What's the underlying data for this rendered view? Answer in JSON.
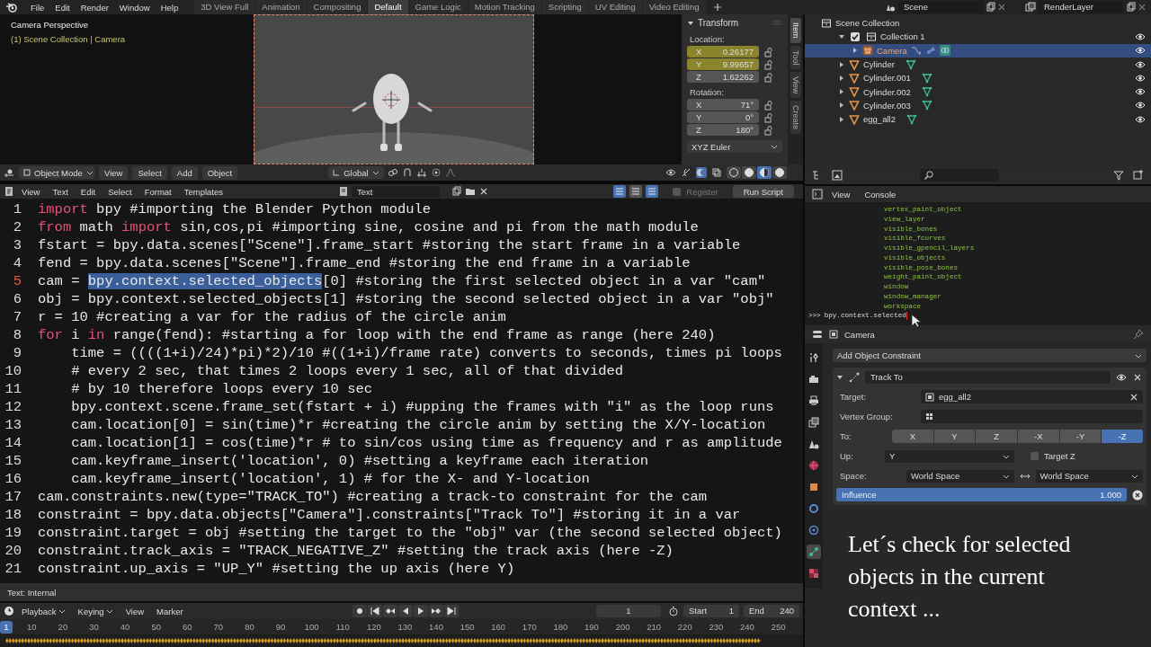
{
  "menu": [
    "File",
    "Edit",
    "Render",
    "Window",
    "Help"
  ],
  "workspaces": [
    {
      "label": "3D View Full",
      "selected": false
    },
    {
      "label": "Animation",
      "selected": false
    },
    {
      "label": "Compositing",
      "selected": false
    },
    {
      "label": "Default",
      "selected": true
    },
    {
      "label": "Game Logic",
      "selected": false
    },
    {
      "label": "Motion Tracking",
      "selected": false
    },
    {
      "label": "Scripting",
      "selected": false
    },
    {
      "label": "UV Editing",
      "selected": false
    },
    {
      "label": "Video Editing",
      "selected": false
    }
  ],
  "scene": "Scene",
  "view_layer": "RenderLayer",
  "viewport": {
    "title": "Camera Perspective",
    "subtitle": "(1) Scene Collection | Camera",
    "mode": "Object Mode",
    "menus": [
      "View",
      "Select",
      "Add",
      "Object"
    ],
    "orientation": "Global",
    "shading_modes": [
      {
        "selected": false
      },
      {
        "selected": false
      },
      {
        "selected": true
      },
      {
        "selected": false
      }
    ]
  },
  "sidebar": {
    "tabs": [
      {
        "label": "Item",
        "selected": true
      },
      {
        "label": "Tool",
        "selected": false
      },
      {
        "label": "View",
        "selected": false
      },
      {
        "label": "Create",
        "selected": false
      }
    ],
    "panel_title": "Transform",
    "location_label": "Location:",
    "location": [
      {
        "axis": "X",
        "value": "0.26177",
        "keyed": true
      },
      {
        "axis": "Y",
        "value": "9.99657",
        "keyed": true
      },
      {
        "axis": "Z",
        "value": "1.62262",
        "keyed": false
      }
    ],
    "rotation_label": "Rotation:",
    "rotation": [
      {
        "axis": "X",
        "value": "71°",
        "keyed": false
      },
      {
        "axis": "Y",
        "value": "0°",
        "keyed": false
      },
      {
        "axis": "Z",
        "value": "180°",
        "keyed": false
      }
    ],
    "rotation_mode": "XYZ Euler"
  },
  "outliner": {
    "root": "Scene Collection",
    "items": [
      {
        "name": "Collection 1",
        "kind": "collection",
        "checked": true,
        "expanded": true,
        "selected": false,
        "children": [
          {
            "name": "Camera",
            "kind": "camera",
            "expanded": false,
            "selected": true
          }
        ]
      },
      {
        "name": "Cylinder",
        "kind": "mesh",
        "expanded": false,
        "selected": false
      },
      {
        "name": "Cylinder.001",
        "kind": "mesh",
        "expanded": false,
        "selected": false
      },
      {
        "name": "Cylinder.002",
        "kind": "mesh",
        "expanded": false,
        "selected": false
      },
      {
        "name": "Cylinder.003",
        "kind": "mesh",
        "expanded": false,
        "selected": false
      },
      {
        "name": "egg_all2",
        "kind": "mesh",
        "expanded": false,
        "selected": false
      }
    ]
  },
  "text_editor": {
    "menus": [
      "View",
      "Text",
      "Edit",
      "Select",
      "Format",
      "Templates"
    ],
    "text_name": "Text",
    "toggles": [
      {
        "on": true
      },
      {
        "on": false
      },
      {
        "on": true
      }
    ],
    "register_label": "Register",
    "register_checked": false,
    "run_button": "Run Script",
    "lines": [
      {
        "number": "1",
        "current": false,
        "segments": [
          {
            "kind": "keyword",
            "text": "import"
          },
          {
            "kind": "plain",
            "text": " bpy #importing the Blender Python module"
          }
        ]
      },
      {
        "number": "2",
        "current": false,
        "segments": [
          {
            "kind": "keyword",
            "text": "from"
          },
          {
            "kind": "plain",
            "text": " math "
          },
          {
            "kind": "keyword",
            "text": "import"
          },
          {
            "kind": "plain",
            "text": " sin,cos,pi #importing sine, cosine and pi from the math module"
          }
        ]
      },
      {
        "number": "3",
        "current": false,
        "segments": [
          {
            "kind": "plain",
            "text": "fstart = bpy.data.scenes[\"Scene\"].frame_start #storing the start frame in a variable"
          }
        ]
      },
      {
        "number": "4",
        "current": false,
        "segments": [
          {
            "kind": "plain",
            "text": "fend = bpy.data.scenes[\"Scene\"].frame_end #storing the end frame in a variable"
          }
        ]
      },
      {
        "number": "5",
        "current": true,
        "segments": [
          {
            "kind": "plain",
            "text": "cam = "
          },
          {
            "kind": "selection",
            "text": "bpy.context.selected_objects"
          },
          {
            "kind": "plain",
            "text": "[0] #storing the first selected object in a var \"cam\""
          }
        ]
      },
      {
        "number": "6",
        "current": false,
        "segments": [
          {
            "kind": "plain",
            "text": "obj = bpy.context.selected_objects[1] #storing the second selected object in a var \"obj\""
          }
        ]
      },
      {
        "number": "7",
        "current": false,
        "segments": [
          {
            "kind": "plain",
            "text": "r = 10 #creating a var for the radius of the circle anim"
          }
        ]
      },
      {
        "number": "8",
        "current": false,
        "segments": [
          {
            "kind": "keyword",
            "text": "for"
          },
          {
            "kind": "plain",
            "text": " i "
          },
          {
            "kind": "keyword",
            "text": "in"
          },
          {
            "kind": "plain",
            "text": " range(fend): #starting a for loop with the end frame as range (here 240)"
          }
        ]
      },
      {
        "number": "9",
        "current": false,
        "segments": [
          {
            "kind": "plain",
            "text": "    time = ((((1+i)/24)*pi)*2)/10 #((1+i)/frame rate) converts to seconds, times pi loops"
          }
        ]
      },
      {
        "number": "10",
        "current": false,
        "segments": [
          {
            "kind": "plain",
            "text": "    # every 2 sec, that times 2 loops every 1 sec, all of that divided"
          }
        ]
      },
      {
        "number": "11",
        "current": false,
        "segments": [
          {
            "kind": "plain",
            "text": "    # by 10 therefore loops every 10 sec"
          }
        ]
      },
      {
        "number": "12",
        "current": false,
        "segments": [
          {
            "kind": "plain",
            "text": "    bpy.context.scene.frame_set(fstart + i) #upping the frames with \"i\" as the loop runs"
          }
        ]
      },
      {
        "number": "13",
        "current": false,
        "segments": [
          {
            "kind": "plain",
            "text": "    cam.location[0] = sin(time)*r #creating the circle anim by setting the X/Y-location"
          }
        ]
      },
      {
        "number": "14",
        "current": false,
        "segments": [
          {
            "kind": "plain",
            "text": "    cam.location[1] = cos(time)*r # to sin/cos using time as frequency and r as amplitude"
          }
        ]
      },
      {
        "number": "15",
        "current": false,
        "segments": [
          {
            "kind": "plain",
            "text": "    cam.keyframe_insert('location', 0) #setting a keyframe each iteration"
          }
        ]
      },
      {
        "number": "16",
        "current": false,
        "segments": [
          {
            "kind": "plain",
            "text": "    cam.keyframe_insert('location', 1) # for the X- and Y-location"
          }
        ]
      },
      {
        "number": "17",
        "current": false,
        "segments": [
          {
            "kind": "plain",
            "text": "cam.constraints.new(type=\"TRACK_TO\") #creating a track-to constraint for the cam"
          }
        ]
      },
      {
        "number": "18",
        "current": false,
        "segments": [
          {
            "kind": "plain",
            "text": "constraint = bpy.data.objects[\"Camera\"].constraints[\"Track To\"] #storing it in a var"
          }
        ]
      },
      {
        "number": "19",
        "current": false,
        "segments": [
          {
            "kind": "plain",
            "text": "constraint.target = obj #setting the target to the \"obj\" var (the second selected object)"
          }
        ]
      },
      {
        "number": "20",
        "current": false,
        "segments": [
          {
            "kind": "plain",
            "text": "constraint.track_axis = \"TRACK_NEGATIVE_Z\" #setting the track axis (here -Z)"
          }
        ]
      },
      {
        "number": "21",
        "current": false,
        "segments": [
          {
            "kind": "plain",
            "text": "constraint.up_axis = \"UP_Y\" #setting the up axis (here Y)"
          }
        ]
      }
    ],
    "status": "Text: Internal"
  },
  "timeline": {
    "menus": [
      {
        "label": "Playback",
        "kind": "dropdown"
      },
      {
        "label": "Keying",
        "kind": "dropdown"
      },
      {
        "label": "View",
        "kind": "menu"
      },
      {
        "label": "Marker",
        "kind": "menu"
      }
    ],
    "current_frame": "1",
    "start_label": "Start",
    "start": "1",
    "end_label": "End",
    "end": "240",
    "ruler": [
      {
        "label": "1",
        "selected": true
      },
      {
        "label": "10",
        "selected": false
      },
      {
        "label": "20",
        "selected": false
      },
      {
        "label": "30",
        "selected": false
      },
      {
        "label": "40",
        "selected": false
      },
      {
        "label": "50",
        "selected": false
      },
      {
        "label": "60",
        "selected": false
      },
      {
        "label": "70",
        "selected": false
      },
      {
        "label": "80",
        "selected": false
      },
      {
        "label": "90",
        "selected": false
      },
      {
        "label": "100",
        "selected": false
      },
      {
        "label": "110",
        "selected": false
      },
      {
        "label": "120",
        "selected": false
      },
      {
        "label": "130",
        "selected": false
      },
      {
        "label": "140",
        "selected": false
      },
      {
        "label": "150",
        "selected": false
      },
      {
        "label": "160",
        "selected": false
      },
      {
        "label": "170",
        "selected": false
      },
      {
        "label": "180",
        "selected": false
      },
      {
        "label": "190",
        "selected": false
      },
      {
        "label": "200",
        "selected": false
      },
      {
        "label": "210",
        "selected": false
      },
      {
        "label": "220",
        "selected": false
      },
      {
        "label": "230",
        "selected": false
      },
      {
        "label": "240",
        "selected": false
      },
      {
        "label": "250",
        "selected": false
      }
    ]
  },
  "console": {
    "menus": [
      "View",
      "Console"
    ],
    "lines": [
      "vertex_paint_object",
      "view_layer",
      "visible_bones",
      "visible_fcurves",
      "visible_gpencil_layers",
      "visible_objects",
      "visible_pose_bones",
      "weight_paint_object",
      "window",
      "window_manager",
      "workspace"
    ],
    "prompt": ">>>",
    "input": "bpy.context.selected"
  },
  "properties": {
    "object_name": "Camera",
    "tabs": [
      {
        "selected": false
      },
      {
        "selected": false
      },
      {
        "selected": false
      },
      {
        "selected": false
      },
      {
        "selected": false
      },
      {
        "selected": false
      },
      {
        "selected": false
      },
      {
        "selected": false
      },
      {
        "selected": false
      },
      {
        "selected": true
      },
      {
        "selected": false
      }
    ],
    "add_constraint": "Add Object Constraint",
    "constraint": {
      "name": "Track To",
      "expanded": true,
      "target_label": "Target:",
      "target": "egg_all2",
      "vertex_group_label": "Vertex Group:",
      "to_label": "To:",
      "to_axes": [
        {
          "label": "X",
          "selected": false
        },
        {
          "label": "Y",
          "selected": false
        },
        {
          "label": "Z",
          "selected": false
        },
        {
          "label": "-X",
          "selected": false
        },
        {
          "label": "-Y",
          "selected": false
        },
        {
          "label": "-Z",
          "selected": true
        }
      ],
      "up_label": "Up:",
      "up": "Y",
      "target_z_label": "Target Z",
      "target_z_checked": false,
      "space_label": "Space:",
      "owner_space": "World Space",
      "target_space": "World Space",
      "influence": {
        "label": "Influence",
        "reading": "1.000",
        "level": 1
      }
    }
  },
  "caption": "Let´s check for selected objects in the current context ..."
}
